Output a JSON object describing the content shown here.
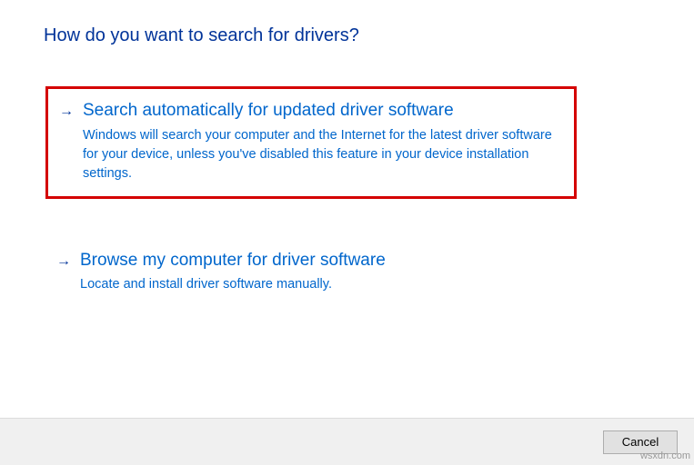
{
  "page": {
    "title": "How do you want to search for drivers?"
  },
  "options": {
    "auto": {
      "title": "Search automatically for updated driver software",
      "description": "Windows will search your computer and the Internet for the latest driver software for your device, unless you've disabled this feature in your device installation settings."
    },
    "manual": {
      "title": "Browse my computer for driver software",
      "description": "Locate and install driver software manually."
    }
  },
  "footer": {
    "cancel_label": "Cancel"
  },
  "watermark": "wsxdn.com"
}
